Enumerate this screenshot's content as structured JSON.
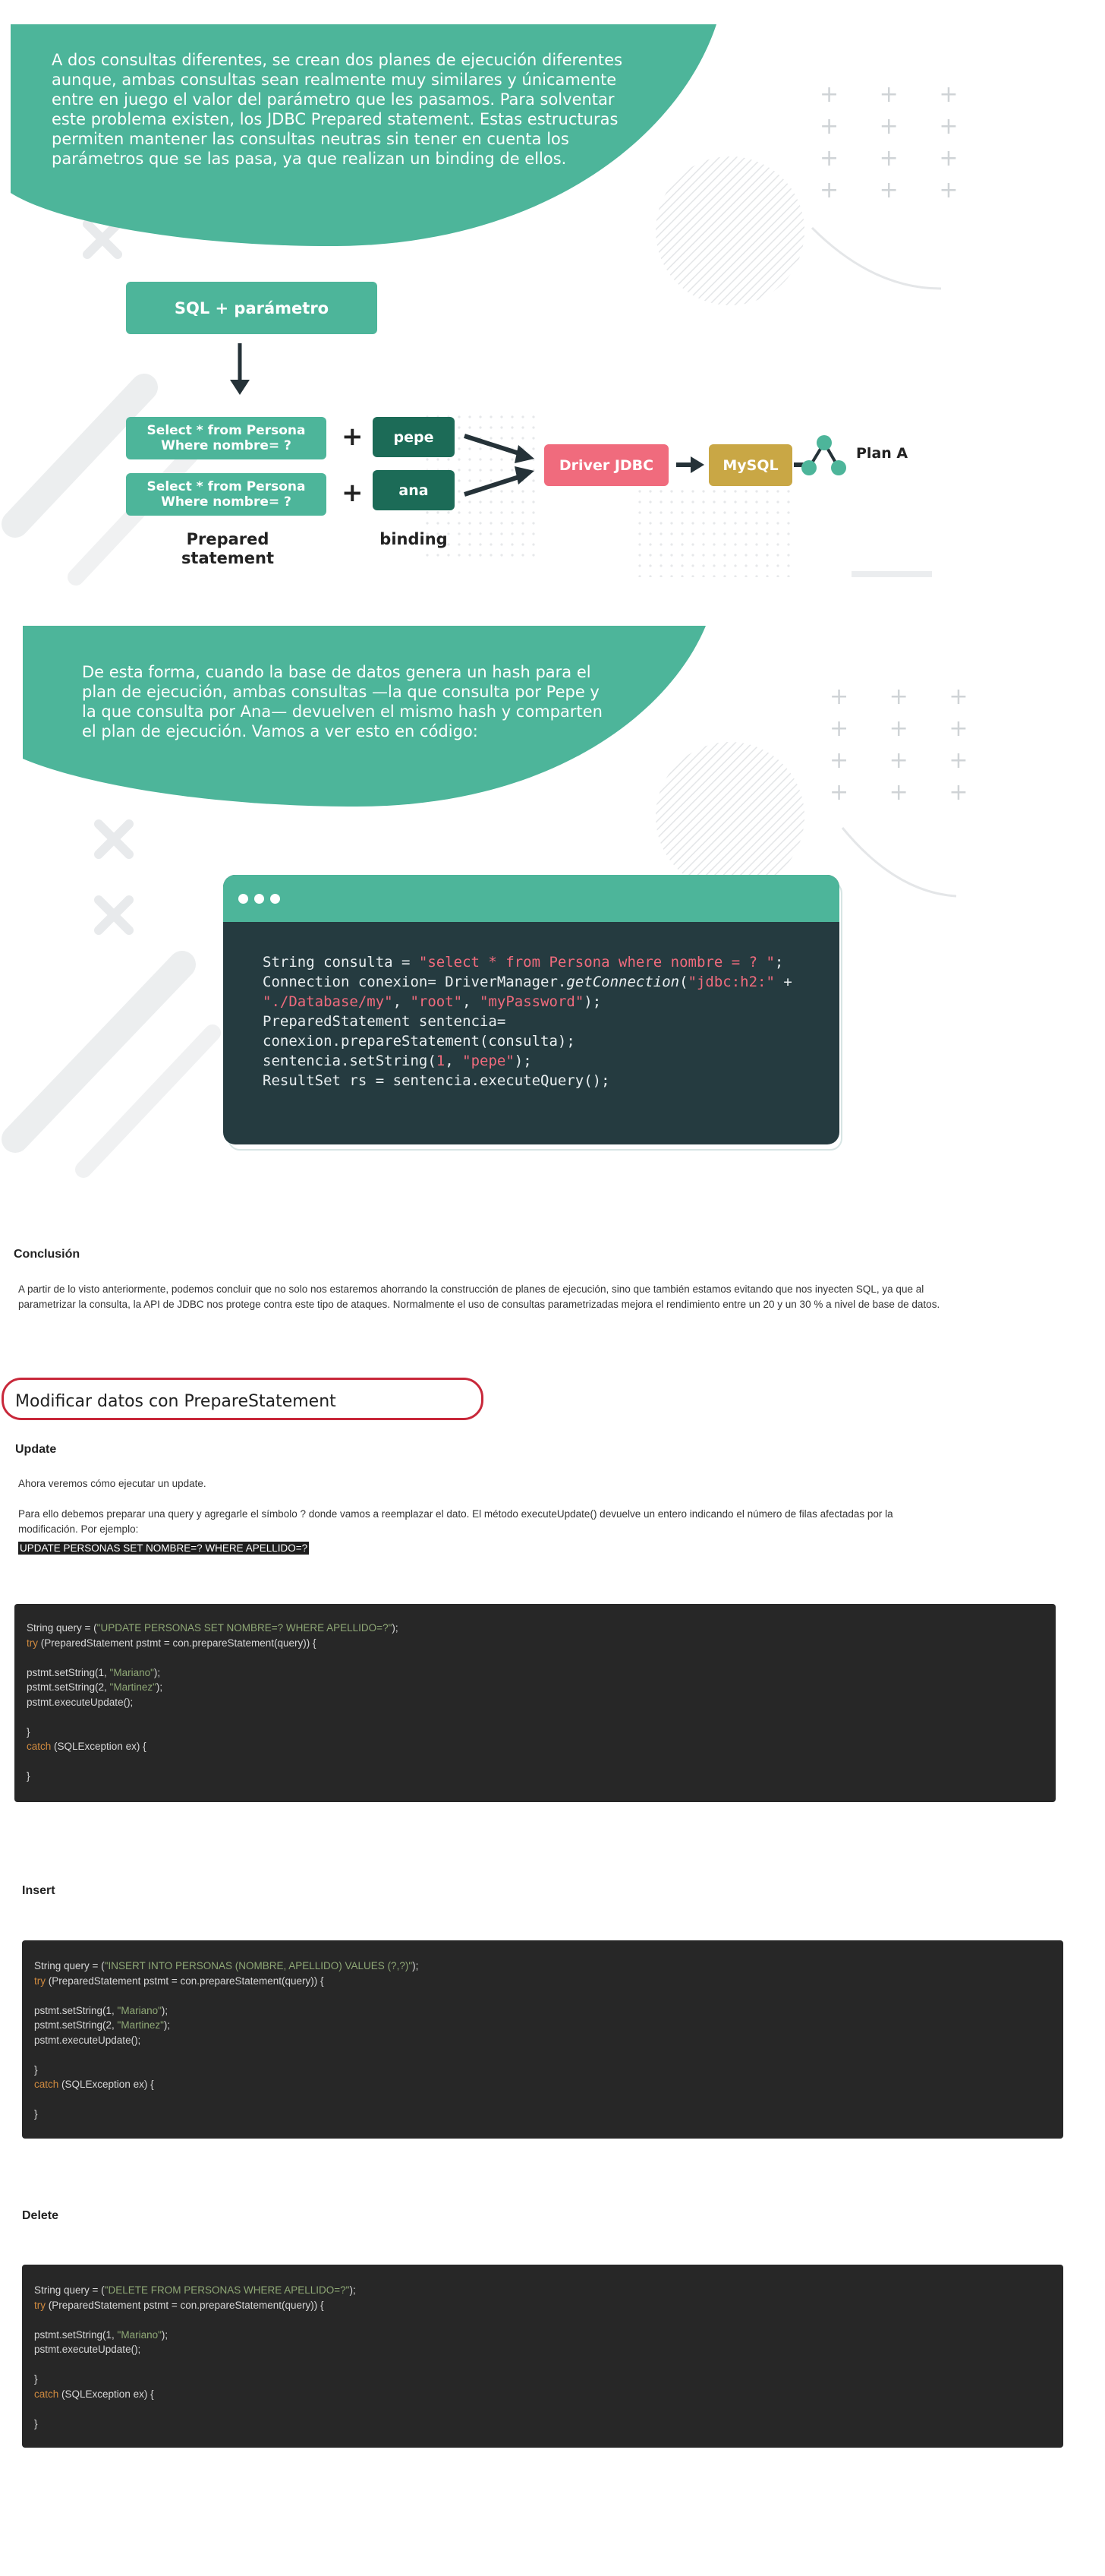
{
  "intro_callout": {
    "lines": [
      "A dos consultas diferentes, se crean dos planes de ejecución diferentes",
      "aunque, ambas consultas sean realmente muy similares y únicamente",
      "entre en juego el valor del parámetro que les pasamos. Para solventar",
      "este problema existen, los JDBC Prepared statement. Estas estructuras",
      "permiten mantener las consultas neutras sin tener en cuenta los",
      "parámetros que se las pasa, ya que realizan un binding de ellos."
    ]
  },
  "diagram": {
    "top_box": "SQL + parámetro",
    "query_line1": "Select * from Persona",
    "query_line2": "Where nombre= ?",
    "plus": "+",
    "param1": "pepe",
    "param2": "ana",
    "label_prepared_1": "Prepared",
    "label_prepared_2": "statement",
    "label_binding": "binding",
    "driver": "Driver JDBC",
    "db": "MySQL",
    "plan": "Plan A",
    "colors": {
      "teal": "#4db59a",
      "dark_teal": "#1c6b57",
      "pink": "#f06b7d",
      "gold": "#c9a745"
    }
  },
  "second_callout": {
    "lines": [
      "De esta forma, cuando la base de datos genera un hash para el",
      "plan de ejecución, ambas consultas —la que consulta por Pepe y",
      "la que consulta por Ana— devuelven el mismo hash y comparten",
      "el plan de ejecución. Vamos a ver esto en código:"
    ]
  },
  "editor_code": {
    "l1a": "String consulta = ",
    "l1b": "\"select * from Persona where nombre = ? \"",
    "l1c": ";",
    "l2a": "Connection conexion= DriverManager.",
    "l2b": "getConnection",
    "l2c": "(",
    "l2d": "\"jdbc:h2:\"",
    "l2e": " +",
    "l3a": "\"./Database/my\"",
    "l3b": ", ",
    "l3c": "\"root\"",
    "l3d": ", ",
    "l3e": "\"myPassword\"",
    "l3f": ");",
    "l4": "PreparedStatement sentencia=",
    "l5": "conexion.prepareStatement(consulta);",
    "l6a": "sentencia.setString(",
    "l6b": "1",
    "l6c": ", ",
    "l6d": "\"pepe\"",
    "l6e": ");",
    "l7": "ResultSet rs = sentencia.executeQuery();"
  },
  "conclusion": {
    "heading": "Conclusión",
    "line1": "A partir de lo visto anteriormente, podemos concluir que no solo nos estaremos ahorrando la construcción de planes de ejecución, sino que también estamos evitando que nos inyecten SQL, ya que al",
    "line2": "parametrizar la consulta, la API de JDBC nos protege contra este tipo de ataques. Normalmente el uso de consultas parametrizadas mejora el rendimiento entre un 20 y un 30 % a nivel de base de datos."
  },
  "section": {
    "title": "Modificar datos con PrepareStatement",
    "update_heading": "Update",
    "update_intro": "Ahora veremos cómo ejecutar un update.",
    "update_p1": "Para ello debemos preparar una query y agregarle el símbolo ? donde vamos a reemplazar el dato. El método executeUpdate() devuelve un entero indicando el número de filas afectadas por la",
    "update_p2": "modificación. Por ejemplo:",
    "update_sql": "UPDATE PERSONAS SET NOMBRE=? WHERE APELLIDO=?",
    "insert_heading": "Insert",
    "delete_heading": "Delete"
  },
  "update_code": {
    "l1a": "String query = (",
    "l1b": "\"UPDATE PERSONAS SET NOMBRE=? WHERE APELLIDO=?\"",
    "l1c": ");",
    "l2a": "try",
    "l2b": " (PreparedStatement pstmt = con.prepareStatement(query)) {",
    "l3a": "pstmt.setString(1, ",
    "l3b": "\"Mariano\"",
    "l3c": ");",
    "l4a": "pstmt.setString(2, ",
    "l4b": "\"Martinez\"",
    "l4c": ");",
    "l5": "pstmt.executeUpdate();",
    "l6": "}",
    "l7a": "catch",
    "l7b": " (SQLException ex) {",
    "l8": "}"
  },
  "insert_code": {
    "l1a": "String query = (",
    "l1b": "\"INSERT INTO PERSONAS (NOMBRE, APELLIDO) VALUES (?,?)\"",
    "l1c": ");",
    "l2a": "try",
    "l2b": " (PreparedStatement pstmt = con.prepareStatement(query)) {",
    "l3a": "pstmt.setString(1, ",
    "l3b": "\"Mariano\"",
    "l3c": ");",
    "l4a": "pstmt.setString(2, ",
    "l4b": "\"Martinez\"",
    "l4c": ");",
    "l5": "pstmt.executeUpdate();",
    "l6": "}",
    "l7a": "catch",
    "l7b": " (SQLException ex) {",
    "l8": "}"
  },
  "delete_code": {
    "l1a": "String query = (",
    "l1b": "\"DELETE FROM PERSONAS WHERE APELLIDO=?\"",
    "l1c": ");",
    "l2a": "try",
    "l2b": " (PreparedStatement pstmt = con.prepareStatement(query)) {",
    "l3a": "pstmt.setString(1, ",
    "l3b": "\"Mariano\"",
    "l3c": ");",
    "l4": "pstmt.executeUpdate();",
    "l5": "}",
    "l6a": "catch",
    "l6b": " (SQLException ex) {",
    "l7": "}"
  }
}
